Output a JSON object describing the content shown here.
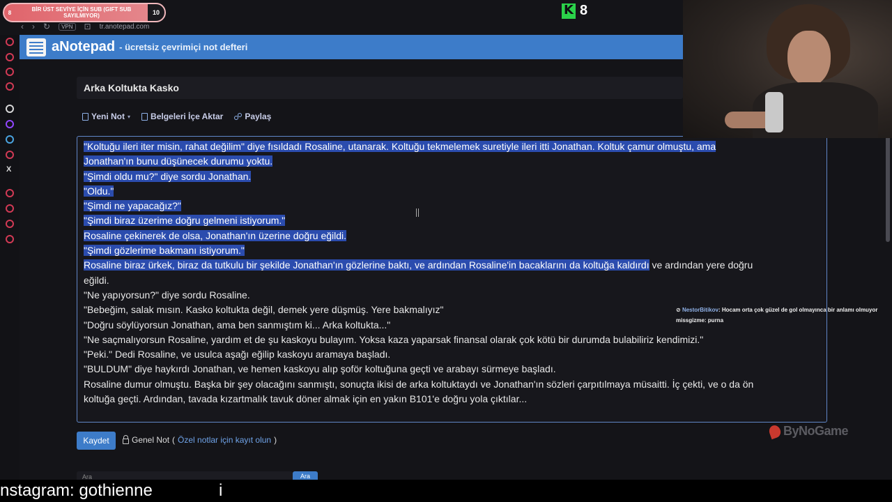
{
  "overlay": {
    "sub_goal": {
      "left_number": "8",
      "text": "BİR ÜST SEVİYE İÇİN SUB (GIFT SUB SAYILMIYOR)",
      "right_number": "10"
    },
    "kick_viewers": "8"
  },
  "browser": {
    "vpn_label": "VPN",
    "url": "tr.anotepad.com"
  },
  "site": {
    "brand": "aNotepad",
    "tagline": "- ücretsiz çevrimiçi not defteri"
  },
  "note": {
    "title": "Arka Koltukta Kasko",
    "toolbar": {
      "new_note": "Yeni Not",
      "import_docs": "Belgeleri İçe Aktar",
      "share": "Paylaş"
    },
    "lines": [
      {
        "sel": "\"Koltuğu ileri iter misin, rahat değilim\" diye fısıldadı Rosaline, utanarak. Koltuğu tekmelemek suretiyle ileri itti Jonathan. Koltuk çamur olmuştu, ama",
        "rest": ""
      },
      {
        "sel": "Jonathan'ın bunu düşünecek durumu yoktu.",
        "rest": ""
      },
      {
        "sel": "\"Şimdi oldu mu?\" diye sordu Jonathan.",
        "rest": ""
      },
      {
        "sel": "\"Oldu.\"",
        "rest": ""
      },
      {
        "sel": "\"Şimdi ne yapacağız?\"",
        "rest": ""
      },
      {
        "sel": "\"Şimdi biraz üzerime doğru gelmeni istiyorum.\"",
        "rest": ""
      },
      {
        "sel": "Rosaline çekinerek de olsa, Jonathan'ın üzerine doğru eğildi.",
        "rest": ""
      },
      {
        "sel": "\"Şimdi gözlerime bakmanı istiyorum.\"",
        "rest": ""
      },
      {
        "sel": "Rosaline biraz ürkek, biraz da tutkulu bir şekilde Jonathan'ın gözlerine baktı, ve ardından Rosaline'in bacaklarını da koltuğa kaldırdı",
        "rest": " ve ardından yere doğru"
      },
      {
        "sel": "",
        "rest": "eğildi."
      },
      {
        "sel": "",
        "rest": "\"Ne yapıyorsun?\" diye sordu Rosaline."
      },
      {
        "sel": "",
        "rest": "\"Bebeğim, salak mısın. Kasko koltukta değil, demek yere düşmüş. Yere bakmalıyız\""
      },
      {
        "sel": "",
        "rest": "\"Doğru söylüyorsun Jonathan, ama ben sanmıştım ki... Arka koltukta...\""
      },
      {
        "sel": "",
        "rest": "\"Ne saçmalıyorsun Rosaline, yardım et de şu kaskoyu bulayım. Yoksa kaza yaparsak finansal olarak çok kötü bir durumda bulabiliriz kendimizi.\""
      },
      {
        "sel": "",
        "rest": "\"Peki.\" Dedi Rosaline, ve usulca aşağı eğilip kaskoyu aramaya başladı."
      },
      {
        "sel": "",
        "rest": "\"BULDUM\" diye haykırdı Jonathan, ve hemen kaskoyu alıp şoför koltuğuna geçti ve arabayı sürmeye başladı."
      },
      {
        "sel": "",
        "rest": "Rosaline dumur olmuştu. Başka bir şey olacağını sanmıştı, sonuçta ikisi de arka koltuktaydı ve Jonathan'ın sözleri çarpıtılmaya müsaitti. İç çekti, ve o da ön"
      },
      {
        "sel": "",
        "rest": "koltuğa geçti. Ardından, tavada kızartmalık tavuk döner almak için en yakın B101'e doğru yola çıktılar..."
      }
    ],
    "save_label": "Kaydet",
    "visibility": {
      "label": "Genel Not",
      "open_paren": "(",
      "link": "Özel notlar için kayıt olun",
      "close_paren": ")"
    },
    "search_placeholder": "Ara",
    "search_button": "Ara"
  },
  "chat": [
    {
      "user": "NestorBitikov",
      "message": ": Hocam orta çok güzel de gol olmayınca bir anlamı olmuyor"
    },
    {
      "user": "missgizme",
      "message": ": purna"
    }
  ],
  "watermark": "ByNoGame",
  "caption": {
    "text": "nstagram: gothienne",
    "extra": "i"
  }
}
